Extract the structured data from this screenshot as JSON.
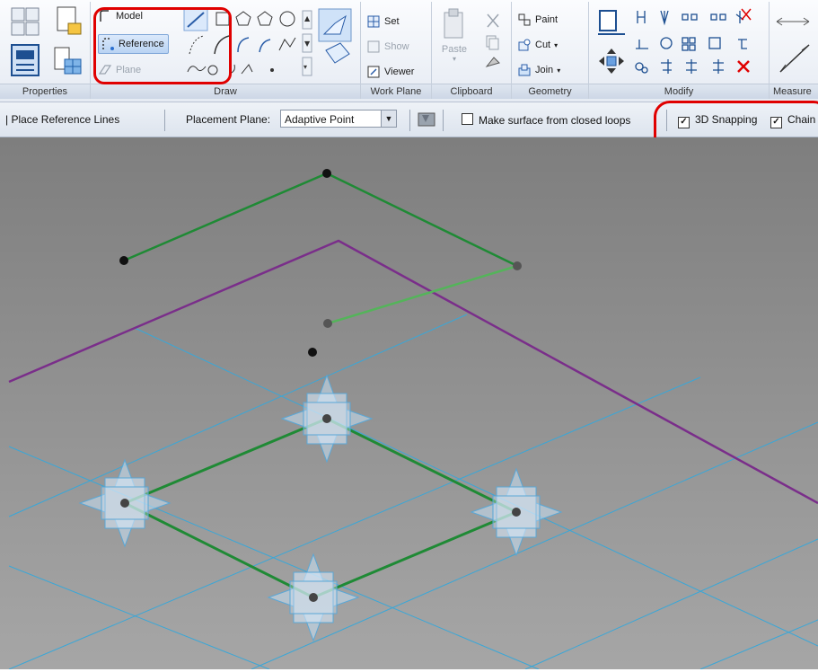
{
  "ribbon": {
    "panels": {
      "properties": "Properties",
      "draw": "Draw",
      "work_plane": "Work Plane",
      "clipboard": "Clipboard",
      "geometry": "Geometry",
      "modify": "Modify",
      "measure": "Measure"
    },
    "draw": {
      "model": "Model",
      "reference": "Reference",
      "plane": "Plane"
    },
    "work_plane": {
      "set": "Set",
      "show": "Show",
      "viewer": "Viewer"
    },
    "clipboard": {
      "paste": "Paste"
    },
    "geometry": {
      "paint": "Paint",
      "cut": "Cut",
      "join": "Join"
    }
  },
  "options_bar": {
    "mode": "Place Reference Lines",
    "placement_plane_label": "Placement Plane:",
    "placement_plane_value": "Adaptive Point",
    "make_surface": "Make surface from closed loops",
    "snapping_3d": "3D Snapping",
    "chain": "Chain",
    "make_surface_checked": false,
    "snapping_3d_checked": true,
    "chain_checked": true
  },
  "colors": {
    "highlight": "#e00000",
    "reference_line": "#1f8a35",
    "boundary": "#7a2e8a",
    "grid": "#39a7d8"
  },
  "icons": [
    "model-line-icon",
    "reference-line-icon",
    "plane-icon",
    "line-icon",
    "arc-icon",
    "polygon-icon",
    "circle-icon",
    "spline-icon",
    "set-workplane-icon",
    "viewer-icon",
    "paste-icon",
    "cut-icon",
    "copy-icon",
    "paint-icon",
    "join-icon",
    "move-icon",
    "rotate-icon",
    "mirror-icon",
    "delete-icon",
    "dimension-icon"
  ]
}
